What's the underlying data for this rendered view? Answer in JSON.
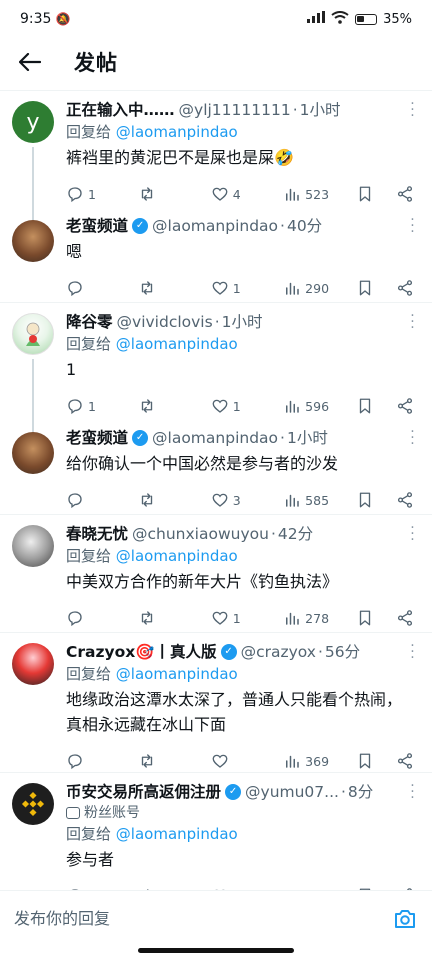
{
  "status": {
    "time": "9:35",
    "battery": "35%"
  },
  "header": {
    "title": "发帖"
  },
  "posts": [
    {
      "name": "正在输入中……",
      "handle": "@ylj11111111",
      "time": "1小时",
      "reply_label": "回复给",
      "reply_to": "@laomanpindao",
      "content": "裤裆里的黄泥巴不是屎也是屎🤣",
      "replies": "1",
      "likes": "4",
      "views": "523",
      "avatar_letter": "y",
      "avatar_color": "#2e7d32"
    },
    {
      "name": "老蛮频道",
      "handle": "@laomanpindao",
      "time": "40分",
      "content": "嗯",
      "replies": "",
      "likes": "1",
      "views": "290",
      "avatar_color": "#8d5a3b"
    },
    {
      "name": "降谷零",
      "handle": "@vividclovis",
      "time": "1小时",
      "reply_label": "回复给",
      "reply_to": "@laomanpindao",
      "content": "1",
      "replies": "1",
      "likes": "1",
      "views": "596",
      "avatar_color": "#c8e6c9"
    },
    {
      "name": "老蛮频道",
      "handle": "@laomanpindao",
      "time": "1小时",
      "content": "给你确认一个中国必然是参与者的沙发",
      "replies": "",
      "likes": "3",
      "views": "585",
      "avatar_color": "#8d5a3b"
    },
    {
      "name": "春晓无忧",
      "handle": "@chunxiaowuyou",
      "time": "42分",
      "reply_label": "回复给",
      "reply_to": "@laomanpindao",
      "content": "中美双方合作的新年大片《钓鱼执法》",
      "replies": "",
      "likes": "1",
      "views": "278",
      "avatar_color": "#9e9e9e"
    },
    {
      "name": "Crazyox🎯丨真人版",
      "handle": "@crazyox",
      "time": "56分",
      "reply_label": "回复给",
      "reply_to": "@laomanpindao",
      "content": "地缘政治这潭水太深了，普通人只能看个热闹，\n真相永远藏在冰山下面",
      "replies": "",
      "likes": "",
      "views": "369",
      "avatar_color": "#c62828"
    },
    {
      "name": "币安交易所高返佣注册",
      "handle": "@yumu07...",
      "time": "8分",
      "tag": "粉丝账号",
      "reply_label": "回复给",
      "reply_to": "@laomanpindao",
      "content": "参与者",
      "replies": "",
      "likes": "",
      "views": "",
      "avatar_color": "#1e1e1e"
    }
  ],
  "bottom": {
    "reply_placeholder": "发布你的回复"
  },
  "colors": {
    "accent": "#1d9bf0",
    "muted": "#536471",
    "binance": "#f0b90b"
  }
}
